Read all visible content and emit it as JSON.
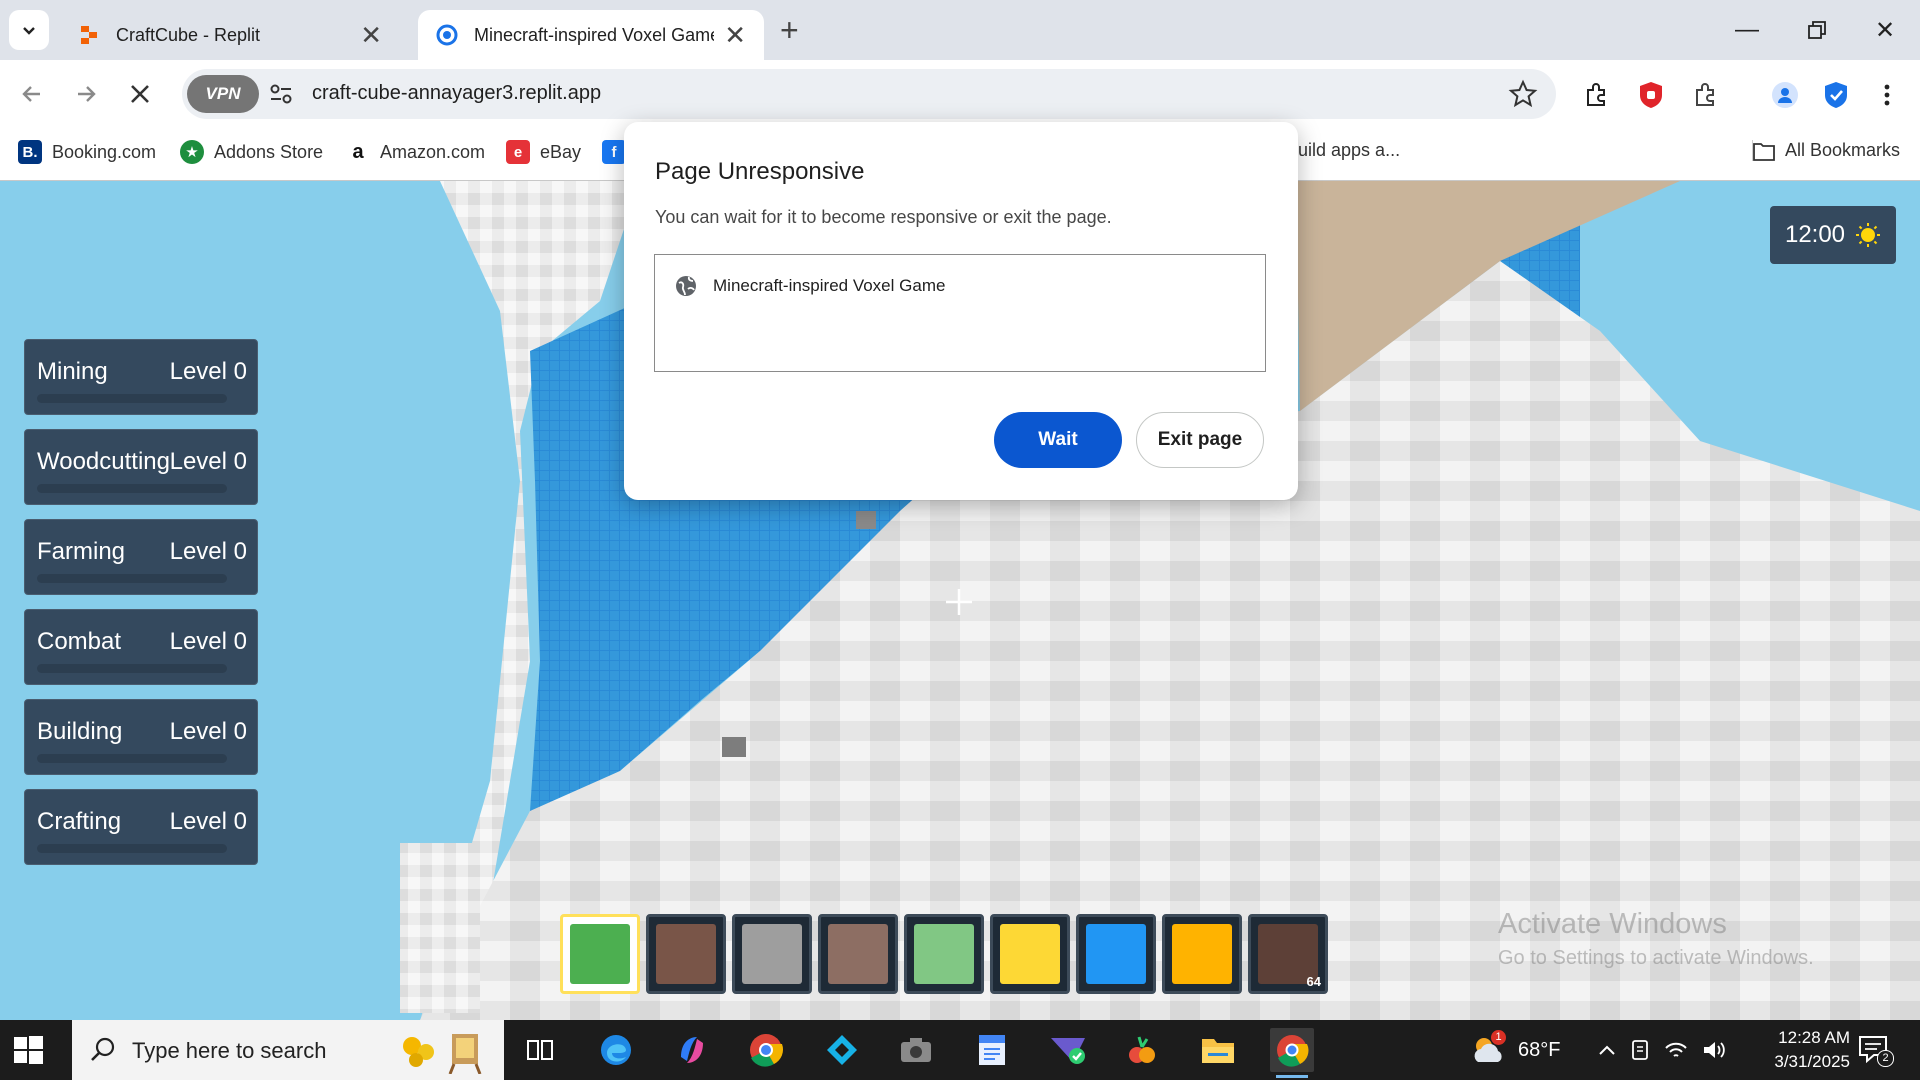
{
  "browser": {
    "tabs": [
      {
        "title": "CraftCube - Replit",
        "active": false
      },
      {
        "title": "Minecraft-inspired Voxel Game",
        "active": true
      }
    ],
    "url": "craft-cube-annayager3.replit.app",
    "vpn_label": "VPN",
    "bookmarks": [
      {
        "label": "Booking.com",
        "icon": "booking-icon"
      },
      {
        "label": "Addons Store",
        "icon": "addons-icon"
      },
      {
        "label": "Amazon.com",
        "icon": "amazon-icon"
      },
      {
        "label": "eBay",
        "icon": "ebay-icon"
      }
    ],
    "bookmark_partial": "uild apps a...",
    "all_bookmarks": "All Bookmarks"
  },
  "game": {
    "skills": [
      {
        "name": "Mining",
        "level": "Level 0",
        "progress": 0
      },
      {
        "name": "Woodcutting",
        "level": "Level 0",
        "progress": 0
      },
      {
        "name": "Farming",
        "level": "Level 0",
        "progress": 0
      },
      {
        "name": "Combat",
        "level": "Level 0",
        "progress": 0
      },
      {
        "name": "Building",
        "level": "Level 0",
        "progress": 0
      },
      {
        "name": "Crafting",
        "level": "Level 0",
        "progress": 0
      }
    ],
    "time": "12:00",
    "hotbar": [
      {
        "color": "#4caf50",
        "selected": true
      },
      {
        "color": "#795548"
      },
      {
        "color": "#9e9e9e"
      },
      {
        "color": "#8d6e63"
      },
      {
        "color": "#81c784"
      },
      {
        "color": "#fdd835"
      },
      {
        "color": "#2196f3"
      },
      {
        "color": "#ffb300"
      },
      {
        "color": "#5d4037",
        "count": "64"
      }
    ]
  },
  "dialog": {
    "title": "Page Unresponsive",
    "message": "You can wait for it to become responsive or exit the page.",
    "page_item": "Minecraft-inspired Voxel Game",
    "wait_label": "Wait",
    "exit_label": "Exit page"
  },
  "watermark": {
    "line1": "Activate Windows",
    "line2": "Go to Settings to activate Windows."
  },
  "taskbar": {
    "search_placeholder": "Type here to search",
    "weather": "68°F",
    "weather_badge": "1",
    "time": "12:28 AM",
    "date": "3/31/2025",
    "notification_count": "2"
  }
}
